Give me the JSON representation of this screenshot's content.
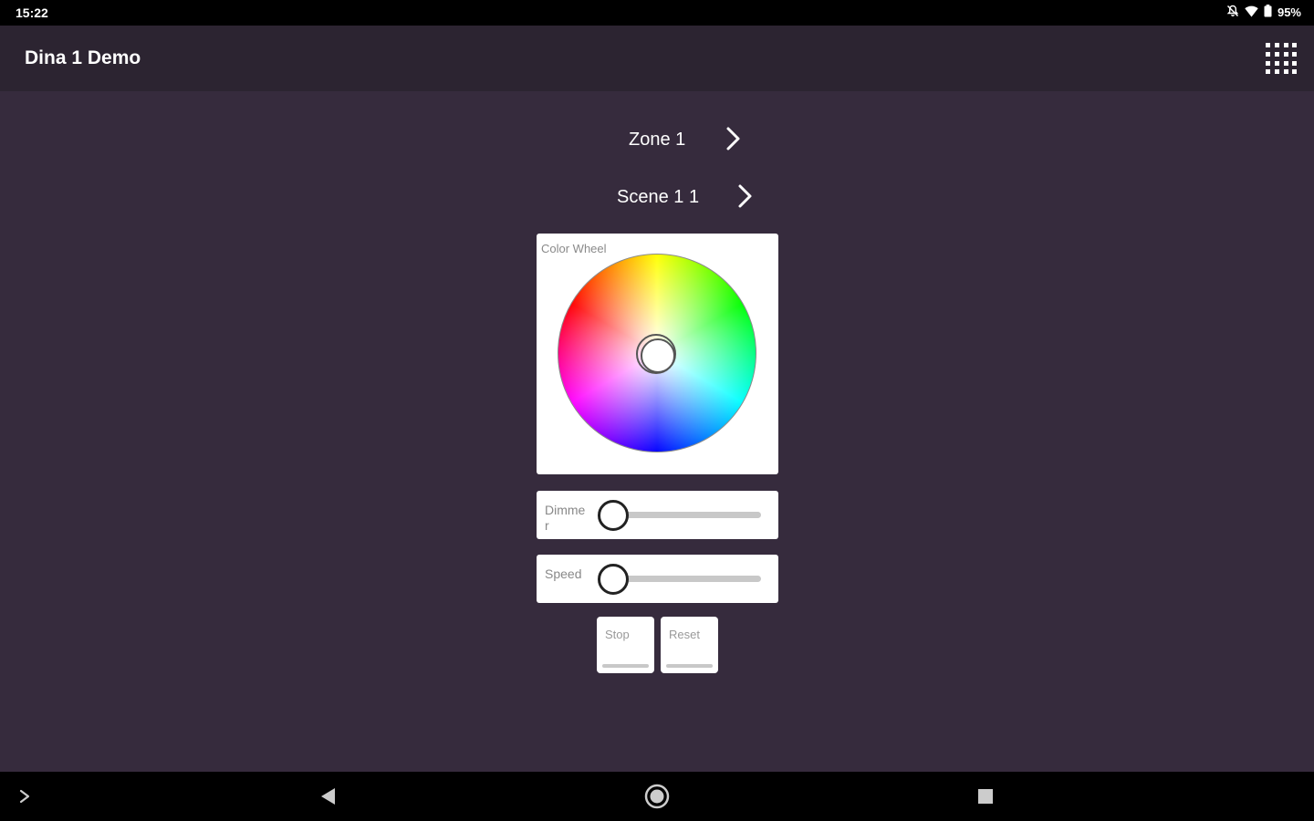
{
  "status_bar": {
    "time": "15:22",
    "battery": "95%"
  },
  "app": {
    "title": "Dina 1 Demo"
  },
  "zone": {
    "label": "Zone 1"
  },
  "scene": {
    "label": "Scene 1 1"
  },
  "color_wheel": {
    "label": "Color Wheel"
  },
  "dimmer": {
    "label": "Dimmer",
    "value": 0
  },
  "speed": {
    "label": "Speed",
    "value": 0
  },
  "buttons": {
    "stop": "Stop",
    "reset": "Reset"
  },
  "icons": {
    "status": [
      "mute-icon",
      "wifi-icon",
      "battery-icon"
    ],
    "app_bar": "grid-menu-icon",
    "nav": [
      "expand-icon",
      "back-icon",
      "home-icon",
      "recents-icon"
    ]
  }
}
